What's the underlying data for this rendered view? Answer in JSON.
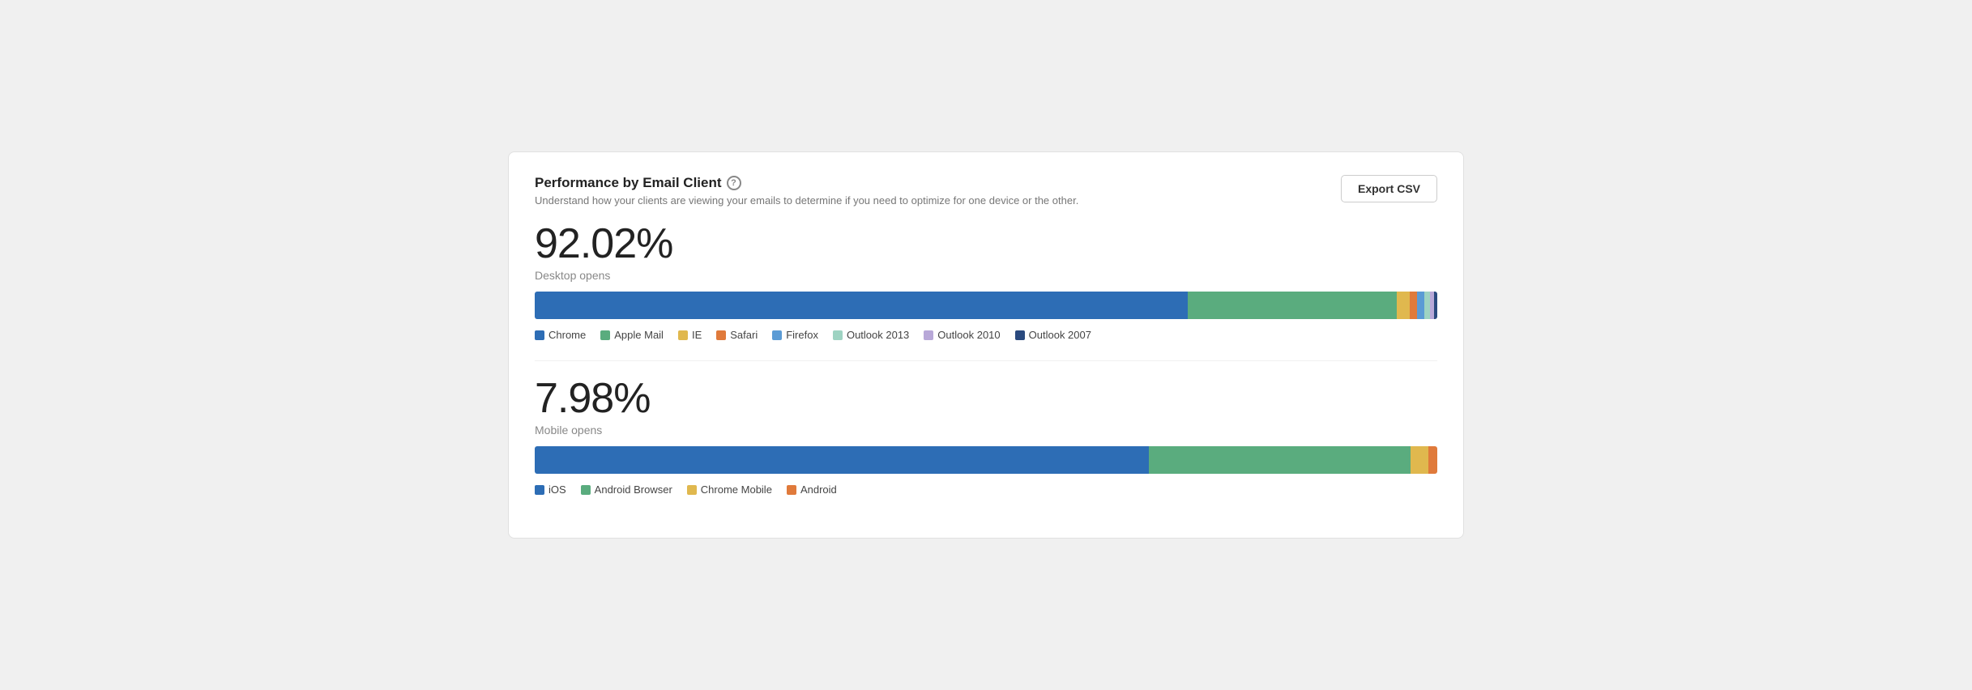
{
  "card": {
    "title": "Performance by Email Client",
    "subtitle": "Understand how your clients are viewing your emails to determine if you need to optimize for one device or the other.",
    "export_button_label": "Export CSV",
    "help_icon_label": "?"
  },
  "desktop": {
    "percentage": "92.02%",
    "label": "Desktop opens",
    "bar_segments": [
      {
        "name": "Chrome",
        "color": "#2d6db5",
        "flex": 72
      },
      {
        "name": "Apple Mail",
        "color": "#5aac7e",
        "flex": 23
      },
      {
        "name": "IE",
        "color": "#e0b84e",
        "flex": 1.5
      },
      {
        "name": "Safari",
        "color": "#e07a3b",
        "flex": 0.8
      },
      {
        "name": "Firefox",
        "color": "#5b9bd5",
        "flex": 0.8
      },
      {
        "name": "Outlook 2013",
        "color": "#9ed3c2",
        "flex": 0.6
      },
      {
        "name": "Outlook 2010",
        "color": "#b8a8d8",
        "flex": 0.4
      },
      {
        "name": "Outlook 2007",
        "color": "#2a4a7f",
        "flex": 0.4
      }
    ],
    "legend": [
      {
        "label": "Chrome",
        "color": "#2d6db5"
      },
      {
        "label": "Apple Mail",
        "color": "#5aac7e"
      },
      {
        "label": "IE",
        "color": "#e0b84e"
      },
      {
        "label": "Safari",
        "color": "#e07a3b"
      },
      {
        "label": "Firefox",
        "color": "#5b9bd5"
      },
      {
        "label": "Outlook 2013",
        "color": "#9ed3c2"
      },
      {
        "label": "Outlook 2010",
        "color": "#b8a8d8"
      },
      {
        "label": "Outlook 2007",
        "color": "#2a4a7f"
      }
    ]
  },
  "mobile": {
    "percentage": "7.98%",
    "label": "Mobile opens",
    "bar_segments": [
      {
        "name": "iOS",
        "color": "#2d6db5",
        "flex": 68
      },
      {
        "name": "Android Browser",
        "color": "#5aac7e",
        "flex": 29
      },
      {
        "name": "Chrome Mobile",
        "color": "#e0b84e",
        "flex": 2
      },
      {
        "name": "Android",
        "color": "#e07a3b",
        "flex": 1
      }
    ],
    "legend": [
      {
        "label": "iOS",
        "color": "#2d6db5"
      },
      {
        "label": "Android Browser",
        "color": "#5aac7e"
      },
      {
        "label": "Chrome Mobile",
        "color": "#e0b84e"
      },
      {
        "label": "Android",
        "color": "#e07a3b"
      }
    ]
  }
}
